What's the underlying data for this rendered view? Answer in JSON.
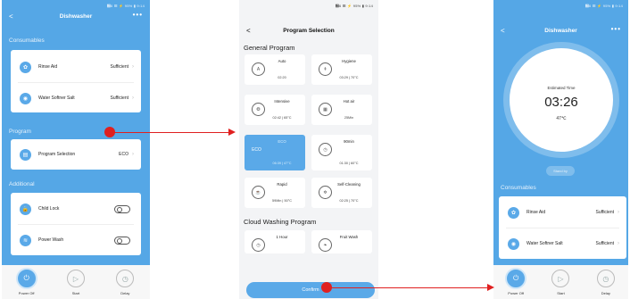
{
  "screen1": {
    "status": "὏6 ☰ ⚡ 95% ▮ 9:14",
    "title": "Dishwasher",
    "back": "<",
    "more": "•••",
    "consumables_label": "Consumables",
    "consumables": [
      {
        "label": "Rinse Aid",
        "value": "Sufficient"
      },
      {
        "label": "Water Softner Salt",
        "value": "Sufficient"
      }
    ],
    "program_label": "Program",
    "program_selection": {
      "label": "Program Selection",
      "value": "ECO"
    },
    "additional_label": "Additional",
    "additional": [
      {
        "label": "Child Lock"
      },
      {
        "label": "Power Wash"
      }
    ],
    "bottom": {
      "power": "Power Off",
      "start": "Start",
      "delay": "Delay"
    }
  },
  "screen2": {
    "status": "὏6 ☰ ⚡ 95% ▮ 9:14",
    "title": "Program Selection",
    "back": "<",
    "general_label": "General Program",
    "programs": [
      {
        "name": "Auto",
        "time": "02:20",
        "icon": "A"
      },
      {
        "name": "Hygiene",
        "time": "03:29 | 70°C",
        "icon": "↟"
      },
      {
        "name": "Intensive",
        "time": "02:42 | 65°C",
        "icon": "❂"
      },
      {
        "name": "Hot air",
        "time": "25Min",
        "icon": "▦"
      },
      {
        "name": "ECO",
        "time": "06:39 | 47°C",
        "icon": "ECO"
      },
      {
        "name": "90min",
        "time": "01:30 | 60°C",
        "icon": "◷"
      },
      {
        "name": "Rapid",
        "time": "59Min | 50°C",
        "icon": "☕"
      },
      {
        "name": "Self-Cleaning",
        "time": "02:25 | 70°C",
        "icon": "✲"
      },
      {
        "name": "1 Hour",
        "time": "",
        "icon": "◷"
      },
      {
        "name": "Fruit Wash",
        "time": "",
        "icon": "❧"
      }
    ],
    "cloud_label": "Cloud Washing Program",
    "confirm": "Confirm"
  },
  "screen3": {
    "status": "὏6 ☰ ⚡ 95% ▮ 9:14",
    "title": "Dishwasher",
    "back": "<",
    "more": "•••",
    "estimated_label": "Estimated Time",
    "time": "03:26",
    "temp": "47℃",
    "standby": "Stand by",
    "consumables_label": "Consumables",
    "consumables": [
      {
        "label": "Rinse Aid",
        "value": "Sufficient"
      },
      {
        "label": "Water Softner Salt",
        "value": "Sufficient"
      }
    ],
    "bottom": {
      "power": "Power Off",
      "start": "Start",
      "delay": "Delay"
    }
  },
  "colors": {
    "accent": "#5aa9e8",
    "annotation": "#e02020"
  }
}
